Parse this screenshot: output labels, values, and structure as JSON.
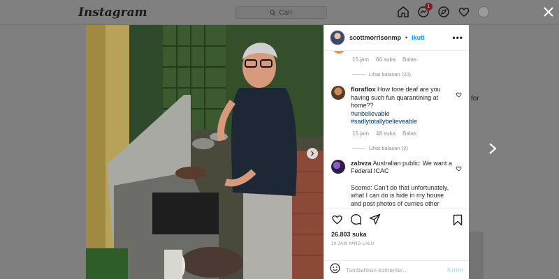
{
  "topbar": {
    "logo": "Instagram",
    "search_placeholder": "Cari",
    "notification_count": "1",
    "icons": [
      "home-icon",
      "messenger-icon",
      "explore-icon",
      "heart-icon",
      "avatar"
    ]
  },
  "background": {
    "side_text": "for"
  },
  "post": {
    "author": "scottmorrisonmp",
    "separator": "•",
    "follow_label": "Ikuti",
    "more_label": "•••"
  },
  "comments": {
    "first_meta": {
      "time": "15 jam",
      "likes": "66 suka",
      "reply": "Balas"
    },
    "first_view_replies": "Lihat balasan (20)",
    "items": [
      {
        "user": "floraflox",
        "text": "How tone deaf are you having such fun quarantining at home??",
        "hashtags": [
          "#unbelievable",
          "#sadlytotallybelieveable"
        ],
        "time": "15 jam",
        "likes": "48 suka",
        "reply": "Balas",
        "view_replies": "Lihat balasan (2)"
      },
      {
        "user": "zabvza",
        "text": "Australian public: We want a Federal ICAC",
        "text2": "Scomo: Can't do that unfortunately, what I can do is hide in my house and post photos of curries other people cook for me"
      }
    ]
  },
  "actions": {
    "likes": "26.803 suka",
    "time_ago": "19 JAM YANG LALU"
  },
  "composer": {
    "placeholder": "Tambahkan komentar...",
    "post_label": "Kirim"
  },
  "colors": {
    "link_blue": "#0095f6",
    "hashtag": "#00376b",
    "muted": "#8e8e8e",
    "overlay": "#7f7f7f"
  }
}
